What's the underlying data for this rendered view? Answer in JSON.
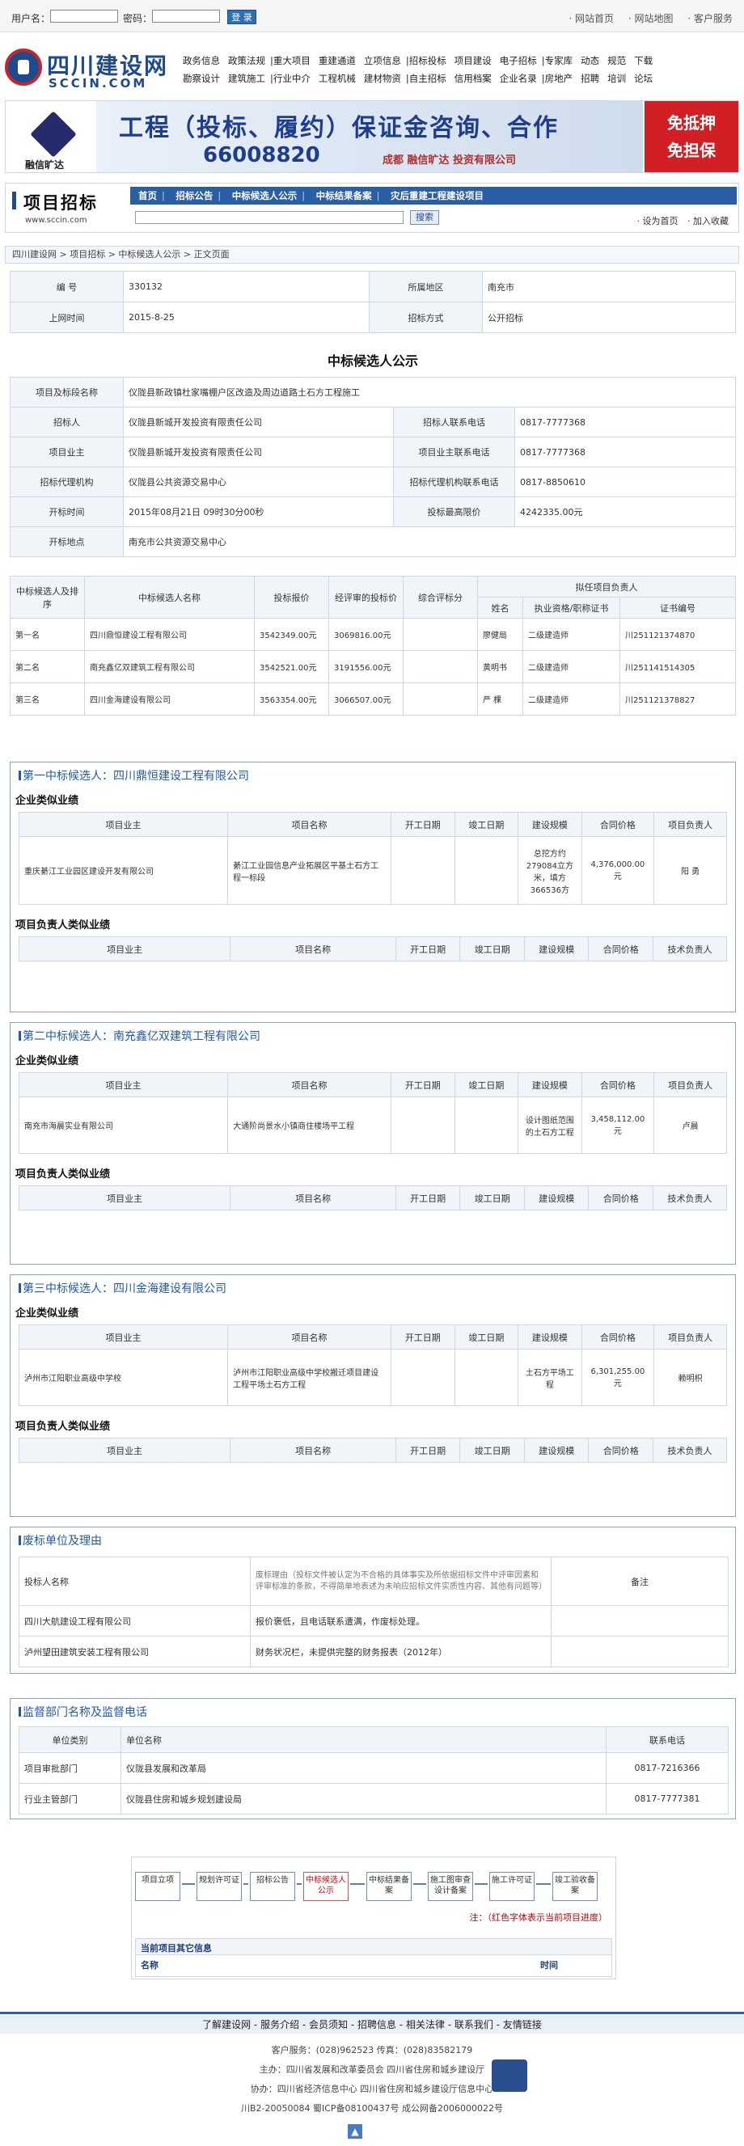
{
  "topbar": {
    "username_label": "用户名：",
    "password_label": "密码：",
    "login_label": "登 录",
    "links": [
      "· 网站首页",
      "· 网站地图",
      "· 客户服务"
    ]
  },
  "logo": {
    "cn": "四川建设网",
    "en": "SCCIN.COM"
  },
  "nav": {
    "row1": [
      [
        "政务信息",
        "政策法规"
      ],
      [
        "重大项目",
        "重建通道",
        "立项信息"
      ],
      [
        "招标投标",
        "项目建设",
        "电子招标"
      ],
      [
        "专家库",
        "动态",
        "规范",
        "下载"
      ]
    ],
    "row2": [
      [
        "勘察设计",
        "建筑施工"
      ],
      [
        "行业中介",
        "工程机械",
        "建材物资"
      ],
      [
        "自主招标",
        "信用档案",
        "企业名录"
      ],
      [
        "房地产",
        "招聘",
        "培训",
        "论坛"
      ]
    ]
  },
  "banner": {
    "brand": "融信旷达",
    "headline": "工程（投标、履约）保证金咨询、合作",
    "phone": "66008820",
    "company": "成都 融信旷达 投资有限公司",
    "badge1": "免抵押",
    "badge2": "免担保"
  },
  "section": {
    "title": "项目招标",
    "url": "www.sccin.com",
    "tabs": [
      "首页",
      "招标公告",
      "中标候选人公示",
      "中标结果备案",
      "灾后重建工程建设项目"
    ],
    "search_button": "搜索",
    "home_link": "· 设为首页",
    "fav_link": "· 加入收藏"
  },
  "breadcrumb": "四川建设网 > 项目招标 > 中标候选人公示 > 正文页面",
  "info": {
    "rows": [
      [
        "编 号",
        "330132",
        "所属地区",
        "南充市"
      ],
      [
        "上网时间",
        "2015-8-25",
        "招标方式",
        "公开招标"
      ]
    ]
  },
  "notice_title": "中标候选人公示",
  "detail": {
    "project_label": "项目及标段名称",
    "project_value": "仪陇县新政镇杜家嘴棚户区改造及周边道路土石方工程施工",
    "rows": [
      [
        "招标人",
        "仪陇县新城开发投资有限责任公司",
        "招标人联系电话",
        "0817-7777368"
      ],
      [
        "项目业主",
        "仪陇县新城开发投资有限责任公司",
        "项目业主联系电话",
        "0817-7777368"
      ],
      [
        "招标代理机构",
        "仪陇县公共资源交易中心",
        "招标代理机构联系电话",
        "0817-8850610"
      ],
      [
        "开标时间",
        "2015年08月21日 09时30分00秒",
        "投标最高限价",
        "4242335.00元"
      ]
    ],
    "place_label": "开标地点",
    "place_value": "南充市公共资源交易中心"
  },
  "candidates": {
    "headers": [
      "中标候选人及排序",
      "中标候选人名称",
      "投标报价",
      "经评审的投标价",
      "综合评标分",
      "拟任项目负责人",
      "姓名",
      "执业资格/职称证书",
      "证书编号"
    ],
    "rows": [
      [
        "第一名",
        "四川鼎恒建设工程有限公司",
        "3542349.00元",
        "3069816.00元",
        "",
        "廖健局",
        "二级建造师",
        "川251121374870"
      ],
      [
        "第二名",
        "南充鑫亿双建筑工程有限公司",
        "3542521.00元",
        "3191556.00元",
        "",
        "黄明书",
        "二级建造师",
        "川251141514305"
      ],
      [
        "第三名",
        "四川金海建设有限公司",
        "3563354.00元",
        "3066507.00元",
        "",
        "严 棵",
        "二级建造师",
        "川251121378827"
      ]
    ]
  },
  "perf_headers": [
    "项目业主",
    "项目名称",
    "开工日期",
    "竣工日期",
    "建设规模",
    "合同价格",
    "项目负责人"
  ],
  "pm_headers": [
    "项目业主",
    "项目名称",
    "开工日期",
    "竣工日期",
    "建设规模",
    "合同价格",
    "技术负责人"
  ],
  "perf_title": "企业类似业绩",
  "pm_title": "项目负责人类似业绩",
  "sections": [
    {
      "caption": "第一中标候选人：四川鼎恒建设工程有限公司",
      "row": [
        "重庆綦江工业园区建设开发有限公司",
        "綦江工业园信息产业拓展区平基土石方工程一标段",
        "",
        "",
        "总挖方约279084立方米，填方366536方",
        "4,376,000.00元",
        "阳 勇"
      ]
    },
    {
      "caption": "第二中标候选人：南充鑫亿双建筑工程有限公司",
      "row": [
        "南充市海晨实业有限公司",
        "大通阶尚景水小镇商住楼场平工程",
        "",
        "",
        "设计图纸范围的土石方工程",
        "3,458,112.00元",
        "卢晨"
      ]
    },
    {
      "caption": "第三中标候选人：四川金海建设有限公司",
      "row": [
        "泸州市江阳职业高级中学校",
        "泸州市江阳职业高级中学校搬迁项目建设工程平场土石方工程",
        "",
        "",
        "土石方平场工程",
        "6,301,255.00元",
        "赖明枳"
      ]
    }
  ],
  "reject": {
    "caption": "废标单位及理由",
    "headers": [
      "投标人名称",
      "废标理由（投标文件被认定为不合格的具体事实及所依据招标文件中评审因素和评审标准的条款，不得简单地表述为未响应招标文件实质性内容、其他有问题等）",
      "备注"
    ],
    "rows": [
      [
        "四川大航建设工程有限公司",
        "报价褒低，且电话联系遭满，作废标处理。",
        ""
      ],
      [
        "泸州望田建筑安装工程有限公司",
        "财务状况栏，未提供完整的财务报表（2012年）",
        ""
      ]
    ]
  },
  "supervise": {
    "caption": "监督部门名称及监督电话",
    "headers": [
      "单位类别",
      "单位名称",
      "联系电话"
    ],
    "rows": [
      [
        "项目审批部门",
        "仪陇县发展和改革局",
        "0817-7216366"
      ],
      [
        "行业主管部门",
        "仪陇县住房和城乡规划建设局",
        "0817-7777381"
      ]
    ]
  },
  "flow": {
    "steps": [
      "项目立项",
      "规划许可证",
      "招标公告",
      "中标候选人公示",
      "中标结果备案",
      "施工图审查设计备案",
      "施工许可证",
      "竣工验收备案"
    ],
    "note": "注：（红色字体表示当前项目进度）",
    "other_title": "当前项目其它信息",
    "name_label": "名称",
    "time_label": "时间"
  },
  "footer": {
    "links": "了解建设网 - 服务介绍 - 会员须知 - 招聘信息 - 相关法律 - 联系我们 - 友情链接",
    "service": "客户服务：(028)962523  传真：(028)83582179",
    "host": "主办：四川省发展和改革委员会  四川省住房和城乡建设厅",
    "co": "协办：四川省经济信息中心  四川省住房和城乡建设厅信息中心",
    "icp": "川B2-20050084 蜀ICP备08100437号 成公网备2006000022号"
  }
}
